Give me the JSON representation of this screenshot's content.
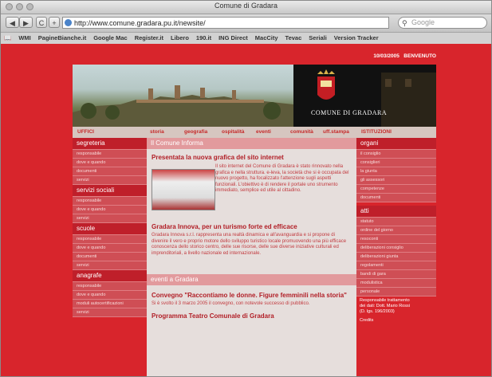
{
  "window": {
    "title": "Comune di Gradara"
  },
  "toolbar": {
    "back": "◀",
    "forward": "▶",
    "reload": "C",
    "add": "+",
    "url": "http://www.comune.gradara.pu.it/newsite/",
    "search_placeholder": "Google"
  },
  "bookmarks": [
    "WMI",
    "PagineBianche.it",
    "Google Mac",
    "Register.it",
    "Libero",
    "190.it",
    "ING Direct",
    "MacCity",
    "Tevac",
    "Seriali",
    "Version Tracker"
  ],
  "topbar": {
    "date": "10/03/2005",
    "welcome": "BENVENUTO"
  },
  "banner": {
    "crest_text": "COMUNE DI GRADARA"
  },
  "nav": {
    "uffici": "UFFICI",
    "links": [
      "storia",
      "geografia",
      "ospitalità",
      "eventi",
      "comunità",
      "uff.stampa"
    ],
    "istituzioni": "ISTITUZIONI"
  },
  "left": [
    {
      "title": "segreteria",
      "items": [
        "responsabile",
        "dove e quando",
        "documenti",
        "servizi"
      ]
    },
    {
      "title": "servizi sociali",
      "items": [
        "responsabile",
        "dove e quando",
        "servizi"
      ]
    },
    {
      "title": "scuole",
      "items": [
        "responsabile",
        "dove e quando",
        "documenti",
        "servizi"
      ]
    },
    {
      "title": "anagrafe",
      "items": [
        "responsabile",
        "dove e quando",
        "moduli autocertificazioni",
        "servizi"
      ]
    }
  ],
  "right": [
    {
      "title": "organi",
      "items": [
        "il consiglio",
        "consiglieri",
        "la giunta",
        "gli assessori",
        "competenze",
        "documenti"
      ]
    },
    {
      "title": "atti",
      "items": [
        "statuto",
        "ordine del giorno",
        "resoconti",
        "deliberazioni consiglio",
        "deliberazioni giunta",
        "regolamenti",
        "bandi di gara",
        "modulistica",
        "personale"
      ]
    }
  ],
  "right_footer": {
    "line1": "Responsabile trattamento",
    "line2": "dei dati: Dott. Mario Rossi",
    "line3": "(D. lgs. 196/2003)",
    "credits": "Credits"
  },
  "center": {
    "header1": "Il Comune Informa",
    "news1_title": "Presentata la nuova grafica del sito internet",
    "news1_body": "Il sito internet del Comune di Gradara è stato rinnovato nella grafica e nella struttura. e-leva, la società che si è occupata del nuovo progetto, ha focalizzato l'attenzione sugli aspetti funzionali. L'obiettivo è di rendere il portale uno strumento immediato, semplice ed utile al cittadino.",
    "news2_title": "Gradara Innova, per un turismo forte ed efficace",
    "news2_body": "Gradara Innova s.r.l. rappresenta una realtà dinamica e all'avanguardia e si propone di divenire il vero e proprio motore dello sviluppo turistico locale promuovendo una più efficace conoscenza dello storico centro, delle sue risorse, delle sue diverse iniziative culturali ed imprenditoriali, a livello nazionale ed internazionale.",
    "header2": "eventi a Gradara",
    "event1_title": "Convegno \"Raccontiamo le donne. Figure femminili nella storia\"",
    "event1_body": "Si è svolto il 3 marzo 2005 il convegno, con notevole successo di pubblico.",
    "event2_title": "Programma Teatro Comunale di Gradara"
  }
}
